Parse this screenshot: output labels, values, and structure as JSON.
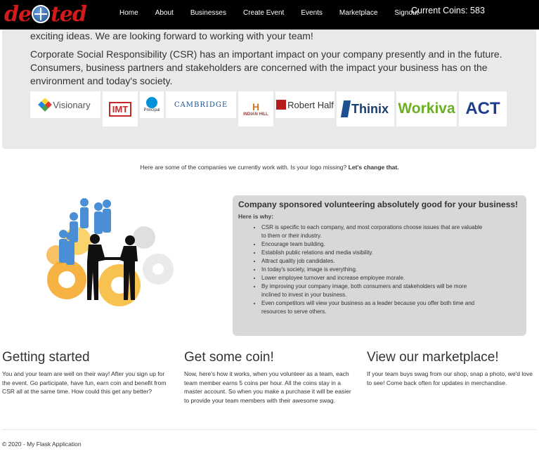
{
  "nav": {
    "brand": "deVoted",
    "links": [
      "Home",
      "About",
      "Businesses",
      "Create Event",
      "Events",
      "Marketplace",
      "Signout"
    ],
    "coins": "Current Coins: 583"
  },
  "hero": {
    "p1": "exciting ideas. We are looking forward to working with your team!",
    "p2": "Corporate Social Responsibility (CSR) has an important impact on your company presently and in the future. Consumers, business partners and stakeholders are concerned with the impact your business has on the environment and today's society.",
    "logos": [
      "Visionary",
      "IMT",
      "Principal",
      "CAMBRIDGE",
      "INDIAN HILL",
      "Robert Half",
      "Thinix",
      "Workiva",
      "ACT"
    ]
  },
  "caption": {
    "text": "Here are some of the companies we currently work with. Is your logo missing? ",
    "link": "Let's change that."
  },
  "csr": {
    "title": "Company sponsored volunteering absolutely good for your business!",
    "subtitle": "Here is why:",
    "items": [
      "CSR is specific to each company, and most corporations choose issues that are valuable to them or their industry.",
      "Encourage team building.",
      "Establish public relations and media visibility.",
      "Attract quality job candidates.",
      "In today's society, image is everything.",
      "Lower employee turnover and increase employee morale.",
      "By improving your company image, both consumers and stakeholders will be more inclined to invest in your business.",
      "Even competitors will view your business as a leader because you offer both time and resources to serve others."
    ]
  },
  "columns": [
    {
      "title": "Getting started",
      "text": "You and your team are well on their way! After you sign up for the event. Go participate, have fun, earn coin and benefit from CSR all at the same time. How could this get any better?"
    },
    {
      "title": "Get some coin!",
      "text": "Now, here's how it works, when you volunteer as a team, each team member earns 5 coins per hour. All the coins stay in a master account. So when you make a purchase it will be easier to provide your team members with their awesome swag."
    },
    {
      "title": "View our marketplace!",
      "text": "If your team buys swag from our shop, snap a photo, we'd love to see! Come back often for updates in merchandise."
    }
  ],
  "footer": "© 2020 - My Flask Application"
}
